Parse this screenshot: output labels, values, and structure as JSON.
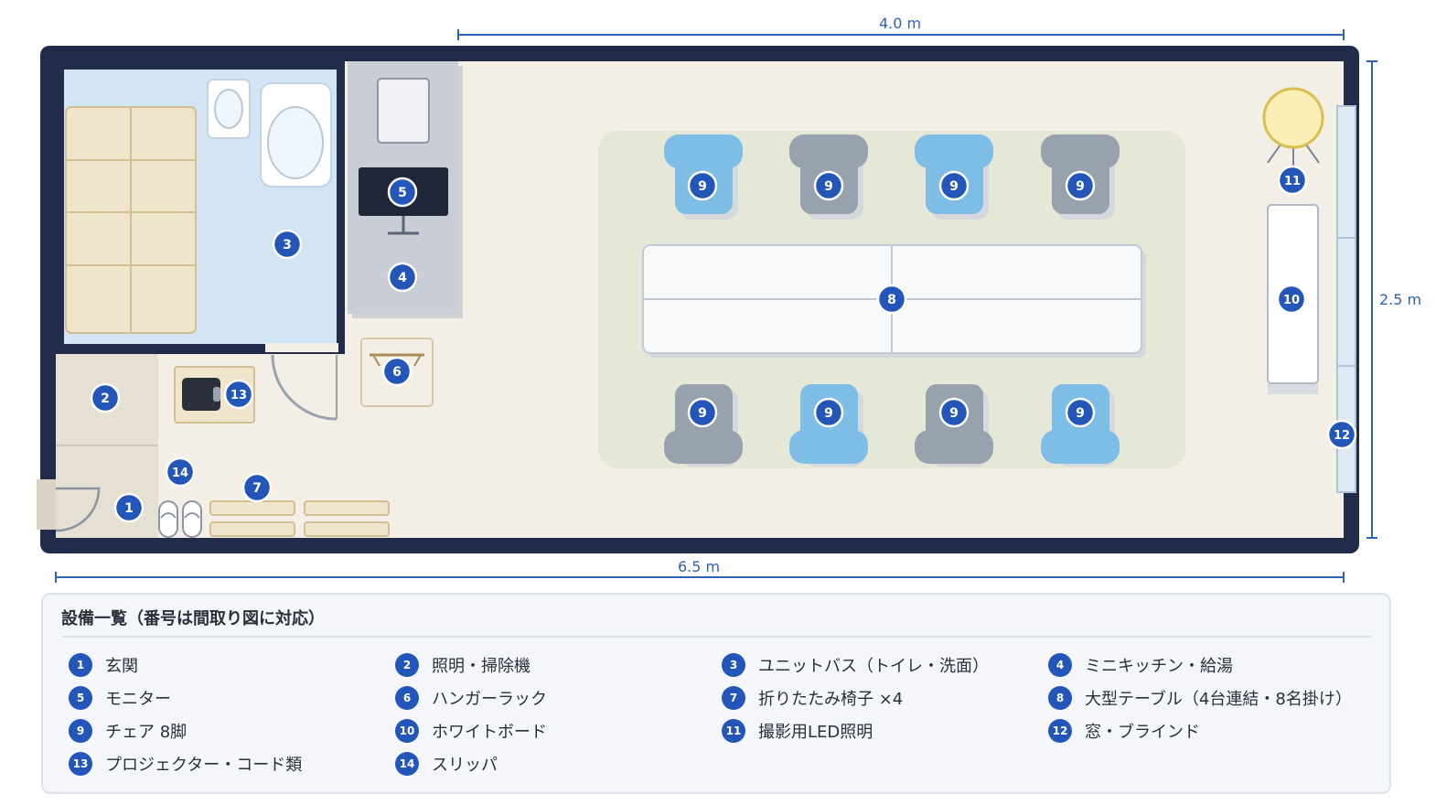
{
  "floor_plan": {
    "dimensions": {
      "width_label": "6.5 m",
      "inner_width_label": "4.0 m",
      "height_label": "2.5 m"
    }
  },
  "legend": {
    "title": "設備一覧（番号は間取り図に対応）",
    "items": [
      {
        "num": "1",
        "label": "玄関"
      },
      {
        "num": "2",
        "label": "照明・掃除機"
      },
      {
        "num": "3",
        "label": "ユニットバス（トイレ・洗面）"
      },
      {
        "num": "4",
        "label": "ミニキッチン・給湯"
      },
      {
        "num": "5",
        "label": "モニター"
      },
      {
        "num": "6",
        "label": "ハンガーラック"
      },
      {
        "num": "7",
        "label": "折りたたみ椅子 ×4"
      },
      {
        "num": "8",
        "label": "大型テーブル（4台連結・8名掛け）"
      },
      {
        "num": "9",
        "label": "チェア 8脚"
      },
      {
        "num": "10",
        "label": "ホワイトボード"
      },
      {
        "num": "11",
        "label": "撮影用LED照明"
      },
      {
        "num": "12",
        "label": "窓・ブラインド"
      },
      {
        "num": "13",
        "label": "プロジェクター・コード類"
      },
      {
        "num": "14",
        "label": "スリッパ"
      }
    ]
  },
  "colors": {
    "wall": "#222c4a",
    "floor": "#f3eee6",
    "bath": "#d3e5f2",
    "kitchen": "#c9ced6",
    "rug": "#e5e8d6",
    "marker": "#2356b8",
    "chair_blue": "#7ebde6",
    "chair_gray": "#98a1ae",
    "dimension": "#2f63b5"
  }
}
